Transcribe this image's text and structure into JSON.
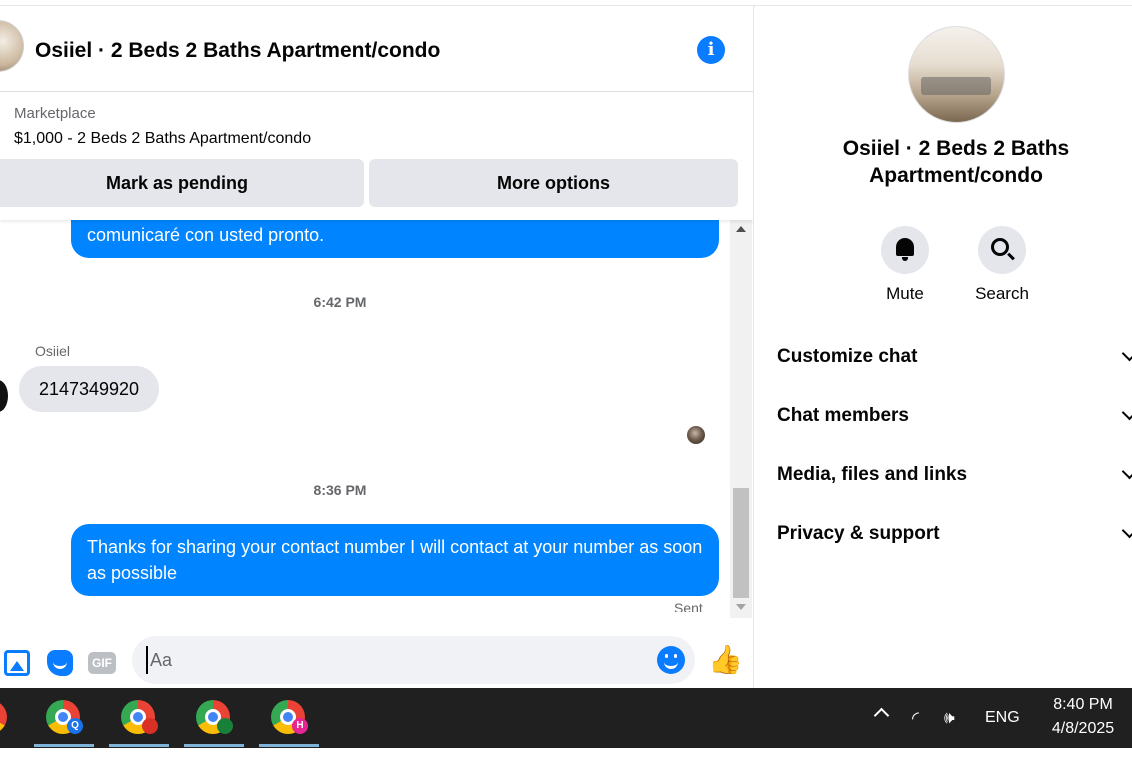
{
  "header": {
    "title": "Osiiel · 2 Beds 2 Baths Apartment/condo",
    "info_icon": "i"
  },
  "listing": {
    "label": "Marketplace",
    "price_line": "$1,000 - 2 Beds 2 Baths Apartment/condo",
    "mark_pending_label": "Mark as pending",
    "more_options_label": "More options"
  },
  "messages": {
    "partial_out": "comunicaré con usted pronto.",
    "time_1": "6:42 PM",
    "sender_name": "Osiiel",
    "incoming": "2147349920",
    "time_2": "8:36 PM",
    "last_out": "Thanks for sharing your contact number I will contact at your number as soon as possible",
    "status": "Sent"
  },
  "composer": {
    "placeholder": "Aa",
    "gif_label": "GIF",
    "like_glyph": "👍"
  },
  "details": {
    "title": "Osiiel · 2 Beds 2 Baths Apartment/condo",
    "mute_label": "Mute",
    "search_label": "Search",
    "sections": [
      "Customize chat",
      "Chat members",
      "Media, files and links",
      "Privacy & support"
    ]
  },
  "taskbar": {
    "badges": [
      "Q",
      "",
      "",
      "H"
    ],
    "wifi_glyph": "◜",
    "volume_glyph": "🕪",
    "language": "ENG",
    "time": "8:40 PM",
    "date": "4/8/2025"
  },
  "colors": {
    "accent": "#0084ff",
    "icon_blue": "#0a7cff",
    "bubble_gray": "#e4e6eb",
    "taskbar": "#202020"
  }
}
